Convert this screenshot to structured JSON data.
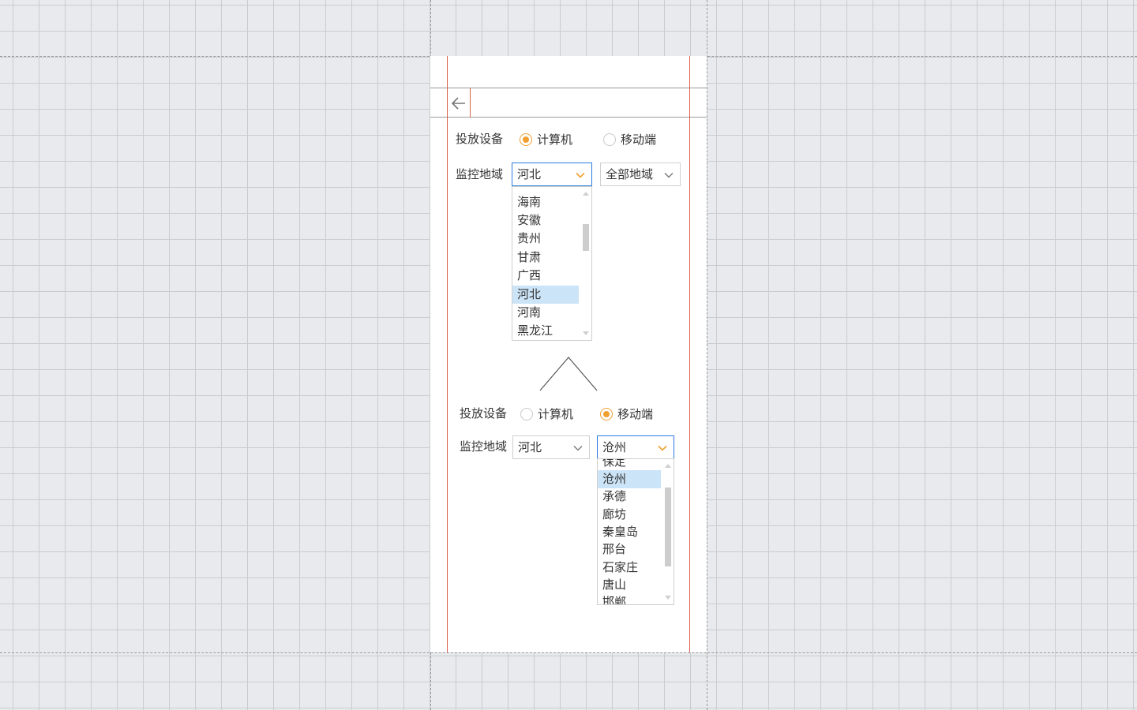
{
  "colors": {
    "accent": "#f0a030",
    "focus": "#2b7de0",
    "selection": "#cce4f7",
    "guide": "#d9604a"
  },
  "panel_top": {
    "device_label": "投放设备",
    "radio_computer": "计算机",
    "radio_mobile": "移动端",
    "selected_device": "计算机",
    "region_label": "监控地域",
    "province_value": "河北",
    "city_value": "全部地域",
    "province_options": [
      "海南",
      "安徽",
      "贵州",
      "甘肃",
      "广西",
      "河北",
      "河南",
      "黑龙江"
    ],
    "selected_province": "河北"
  },
  "panel_bottom": {
    "device_label": "投放设备",
    "radio_computer": "计算机",
    "radio_mobile": "移动端",
    "selected_device": "移动端",
    "region_label": "监控地域",
    "province_value": "河北",
    "city_value": "沧州",
    "city_options": [
      "保定",
      "沧州",
      "承德",
      "廊坊",
      "秦皇岛",
      "邢台",
      "石家庄",
      "唐山",
      "邯郸"
    ],
    "selected_city": "沧州"
  },
  "icons": {
    "back": "arrow-left-icon",
    "dropdown": "chevron-down-icon",
    "transition": "caret-up-icon"
  }
}
